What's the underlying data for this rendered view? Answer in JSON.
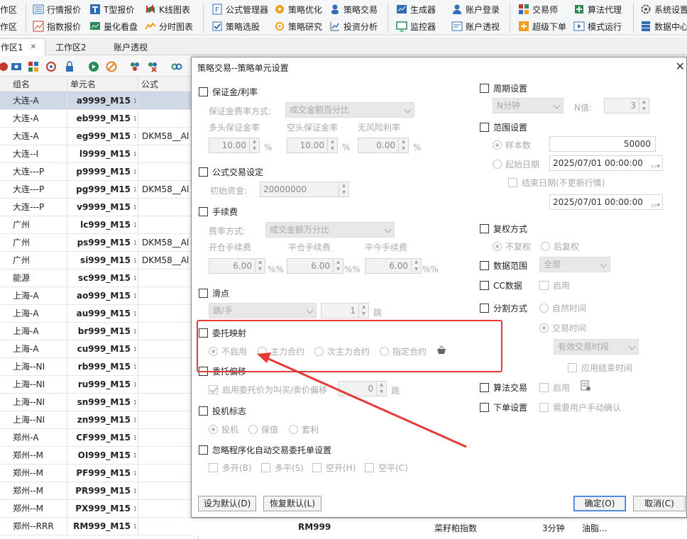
{
  "toolbar": {
    "row1": [
      {
        "label": "作区",
        "icon": "workspace-icon"
      },
      {
        "label": "行情报价",
        "icon": "list-icon"
      },
      {
        "label": "T型报价",
        "icon": "t-quote-icon"
      },
      {
        "label": "K线图表",
        "icon": "kline-icon"
      },
      {
        "label": "公式管理器",
        "icon": "formula-icon"
      },
      {
        "label": "策略优化",
        "icon": "optimize-icon"
      },
      {
        "label": "策略交易",
        "icon": "strategy-trade-icon"
      },
      {
        "label": "生成器",
        "icon": "generator-icon"
      },
      {
        "label": "账户登录",
        "icon": "user-icon"
      },
      {
        "label": "交易师",
        "icon": "trader-icon"
      },
      {
        "label": "算法代理",
        "icon": "algo-icon"
      },
      {
        "label": "系统设置",
        "icon": "gear-icon"
      }
    ],
    "row2": [
      {
        "label": "作区",
        "icon": "workspace-icon"
      },
      {
        "label": "指数报价",
        "icon": "index-icon"
      },
      {
        "label": "量化看盘",
        "icon": "quant-icon"
      },
      {
        "label": "分时图表",
        "icon": "timeshare-icon"
      },
      {
        "label": "策略选股",
        "icon": "stock-pick-icon"
      },
      {
        "label": "策略研究",
        "icon": "research-icon"
      },
      {
        "label": "投资分析",
        "icon": "analysis-icon"
      },
      {
        "label": "监控器",
        "icon": "monitor-icon"
      },
      {
        "label": "账户透视",
        "icon": "account-view-icon"
      },
      {
        "label": "超级下单",
        "icon": "super-order-icon"
      },
      {
        "label": "模式运行",
        "icon": "mode-run-icon"
      },
      {
        "label": "数据中心",
        "icon": "data-center-icon"
      }
    ]
  },
  "tabs": {
    "t1": "作区1",
    "close": "✕",
    "t2": "工作区2",
    "t3": "账户透视"
  },
  "grid": {
    "headers": {
      "group": "组名",
      "unit": "单元名",
      "formula": "公式"
    },
    "rows": [
      {
        "group": "大连-A",
        "unit": "a9999_M15",
        "formula": ""
      },
      {
        "group": "大连-A",
        "unit": "eb999_M15",
        "formula": ""
      },
      {
        "group": "大连-A",
        "unit": "eg999_M15",
        "formula": "DKM58__Al"
      },
      {
        "group": "大连--I",
        "unit": "l9999_M15",
        "formula": ""
      },
      {
        "group": "大连---P",
        "unit": "p9999_M15",
        "formula": ""
      },
      {
        "group": "大连---P",
        "unit": "pg999_M15",
        "formula": "DKM58__Al"
      },
      {
        "group": "大连---P",
        "unit": "v9999_M15",
        "formula": ""
      },
      {
        "group": "广州",
        "unit": "lc999_M15",
        "formula": ""
      },
      {
        "group": "广州",
        "unit": "ps999_M15",
        "formula": "DKM58__Al"
      },
      {
        "group": "广州",
        "unit": "si999_M15",
        "formula": "DKM58__Al"
      },
      {
        "group": "能源",
        "unit": "sc999_M15",
        "formula": ""
      },
      {
        "group": "上海-A",
        "unit": "ao999_M15",
        "formula": ""
      },
      {
        "group": "上海-A",
        "unit": "au999_M15",
        "formula": ""
      },
      {
        "group": "上海-A",
        "unit": "br999_M15",
        "formula": ""
      },
      {
        "group": "上海-A",
        "unit": "cu999_M15",
        "formula": ""
      },
      {
        "group": "上海--NI",
        "unit": "rb999_M15",
        "formula": ""
      },
      {
        "group": "上海--NI",
        "unit": "ru999_M15",
        "formula": ""
      },
      {
        "group": "上海--NI",
        "unit": "sn999_M15",
        "formula": ""
      },
      {
        "group": "上海--NI",
        "unit": "zn999_M15",
        "formula": ""
      },
      {
        "group": "郑州-A",
        "unit": "CF999_M15",
        "formula": ""
      },
      {
        "group": "郑州--M",
        "unit": "OI999_M15",
        "formula": ""
      },
      {
        "group": "郑州--M",
        "unit": "PF999_M15",
        "formula": ""
      },
      {
        "group": "郑州--M",
        "unit": "PR999_M15",
        "formula": ""
      },
      {
        "group": "郑州--M",
        "unit": "PX999_M15",
        "formula": ""
      },
      {
        "group": "郑州--RRR",
        "unit": "RM999_M15",
        "formula": ""
      }
    ],
    "bottom": {
      "code": "RM999",
      "name": "菜籽粕指数",
      "period": "3分钟",
      "extra": "油脂..."
    }
  },
  "dialog": {
    "title": "策略交易--策略单元设置",
    "close": "✕",
    "margin": {
      "title": "保证金/利率",
      "fee_mode_label": "保证金费率方式:",
      "fee_mode_value": "成交金额百分比",
      "long_label": "多头保证金率",
      "short_label": "空头保证金率",
      "riskfree_label": "无风险利率",
      "long_value": "10.00",
      "short_value": "10.00",
      "riskfree_value": "0.00",
      "pct": "%"
    },
    "formula_trade": {
      "title": "公式交易设定",
      "capital_label": "初始资金:",
      "capital_value": "20000000"
    },
    "commission": {
      "title": "手续费",
      "mode_label": "费率方式:",
      "mode_value": "成交金额万分比",
      "open_label": "开仓手续费",
      "close_label": "平仓手续费",
      "closetoday_label": "平今手续费",
      "open_value": "6.00",
      "close_value": "6.00",
      "closetoday_value": "6.00",
      "unit": "%%"
    },
    "slippage": {
      "title": "滑点",
      "mode_value": "跳/手",
      "value": "1",
      "unit": "跳"
    },
    "order_map": {
      "title": "委托映射",
      "options": [
        "不启用",
        "主力合约",
        "次主力合约",
        "指定合约"
      ]
    },
    "order_offset": {
      "title": "委托偏移",
      "enable_label": "启用委托价为叫买/卖价偏移",
      "value": "0",
      "unit": "跳"
    },
    "spec_flag": {
      "title": "投机标志",
      "options": [
        "投机",
        "保值",
        "套利"
      ]
    },
    "ignore": {
      "title": "忽略程序化自动交易委托单设置",
      "options": [
        "多开(B)",
        "多平(S)",
        "空开(H)",
        "空平(C)"
      ]
    },
    "period": {
      "title": "周期设置",
      "mode_value": "N分钟",
      "n_label": "N值:",
      "n_value": "3"
    },
    "range": {
      "title": "范围设置",
      "sample_label": "样本数",
      "sample_value": "50000",
      "start_label": "起始日期",
      "start_value": "2025/07/01 00:00:00",
      "end_label": "结束日期(不更新行情)",
      "end_value": "2025/07/01 00:00:00"
    },
    "adjust": {
      "title": "复权方式",
      "opt1": "不复权",
      "opt2": "后复权"
    },
    "data_range": {
      "title": "数据范围",
      "value": "全部"
    },
    "cc": {
      "title": "CC数据",
      "enable": "启用"
    },
    "split": {
      "title": "分割方式",
      "opt1": "自然时间",
      "opt2": "交易时间",
      "session_value": "有效交易时段",
      "apply_end": "应用结束时间"
    },
    "algo": {
      "title": "算法交易",
      "enable": "启用"
    },
    "order_setting": {
      "title": "下单设置",
      "confirm": "需要用户手动确认"
    },
    "buttons": {
      "set_default": "设为默认(D)",
      "restore_default": "恢复默认(L)",
      "ok": "确定(O)",
      "cancel": "取消(C)"
    }
  },
  "colors": {
    "accent": "#2a6ccf",
    "highlight": "#e53935",
    "selected_row": "#cfd8e6"
  }
}
